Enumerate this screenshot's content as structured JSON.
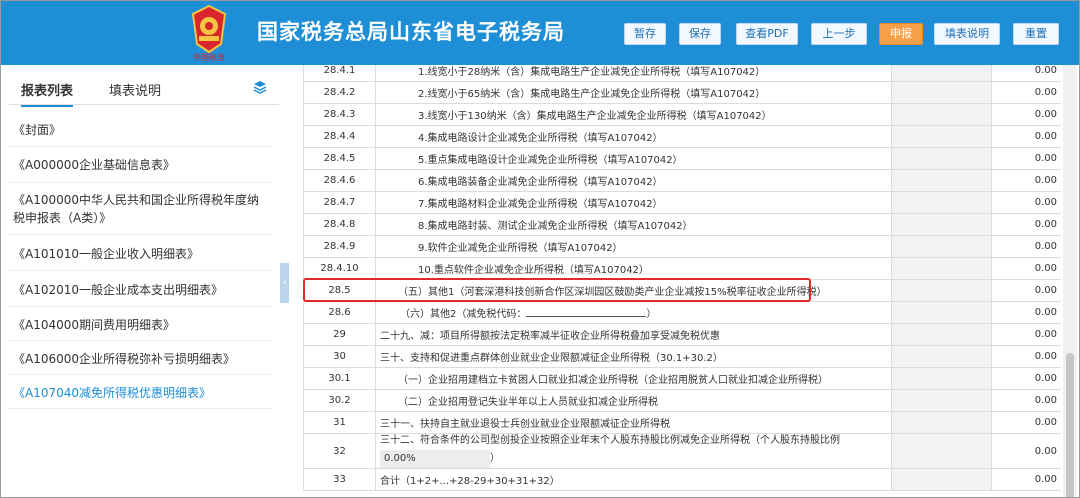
{
  "header": {
    "title": "国家税务总局山东省电子税务局",
    "emblem_text": "中国税务",
    "buttons": {
      "suspend": "暂存",
      "save": "保存",
      "view_pdf": "查看PDF",
      "previous": "上一步",
      "declare": "申报",
      "fill_instructions": "填表说明",
      "reset": "重置"
    }
  },
  "sidebar": {
    "tabs": {
      "report_list": "报表列表",
      "instructions": "填表说明"
    },
    "items": [
      {
        "label": "《封面》"
      },
      {
        "label": "《A000000企业基础信息表》"
      },
      {
        "label": "《A100000中华人民共和国企业所得税年度纳税申报表（A类）》"
      },
      {
        "label": "《A101010一般企业收入明细表》"
      },
      {
        "label": "《A102010一般企业成本支出明细表》"
      },
      {
        "label": "《A104000期间费用明细表》"
      },
      {
        "label": "《A106000企业所得税弥补亏损明细表》"
      },
      {
        "label": "《A107040减免所得税优惠明细表》"
      }
    ]
  },
  "table": {
    "rows": [
      {
        "no": "28.4.1",
        "name": "1.线宽小于28纳米（含）集成电路生产企业减免企业所得税（填写A107042）",
        "amount": "0.00"
      },
      {
        "no": "28.4.2",
        "name": "2.线宽小于65纳米（含）集成电路生产企业减免企业所得税（填写A107042）",
        "amount": "0.00"
      },
      {
        "no": "28.4.3",
        "name": "3.线宽小于130纳米（含）集成电路生产企业减免企业所得税（填写A107042）",
        "amount": "0.00"
      },
      {
        "no": "28.4.4",
        "name": "4.集成电路设计企业减免企业所得税（填写A107042）",
        "amount": "0.00"
      },
      {
        "no": "28.4.5",
        "name": "5.重点集成电路设计企业减免企业所得税（填写A107042）",
        "amount": "0.00"
      },
      {
        "no": "28.4.6",
        "name": "6.集成电路装备企业减免企业所得税（填写A107042）",
        "amount": "0.00"
      },
      {
        "no": "28.4.7",
        "name": "7.集成电路材料企业减免企业所得税（填写A107042）",
        "amount": "0.00"
      },
      {
        "no": "28.4.8",
        "name": "8.集成电路封装、测试企业减免企业所得税（填写A107042）",
        "amount": "0.00"
      },
      {
        "no": "28.4.9",
        "name": "9.软件企业减免企业所得税（填写A107042）",
        "amount": "0.00"
      },
      {
        "no": "28.4.10",
        "name": "10.重点软件企业减免企业所得税（填写A107042）",
        "amount": "0.00"
      },
      {
        "no": "28.5",
        "name": "（五）其他1（河套深港科技创新合作区深圳园区鼓励类产业企业减按15%税率征收企业所得税）",
        "amount": "0.00"
      },
      {
        "no": "28.6",
        "name_prefix": "（六）其他2（减免税代码：",
        "name_suffix": "）",
        "amount": "0.00"
      },
      {
        "no": "29",
        "name": "二十九、减：项目所得额按法定税率减半征收企业所得税叠加享受减免税优惠",
        "amount": "0.00"
      },
      {
        "no": "30",
        "name": "三十、支持和促进重点群体创业就业企业限额减征企业所得税（30.1+30.2）",
        "amount": "0.00"
      },
      {
        "no": "30.1",
        "name": "（一）企业招用建档立卡贫困人口就业扣减企业所得税（企业招用脱贫人口就业扣减企业所得税）",
        "amount": "0.00"
      },
      {
        "no": "30.2",
        "name": "（二）企业招用登记失业半年以上人员就业扣减企业所得税",
        "amount": "0.00"
      },
      {
        "no": "31",
        "name": "三十一、扶持自主就业退役士兵创业就业企业限额减征企业所得税",
        "amount": "0.00"
      },
      {
        "no": "32",
        "name": "三十二、符合条件的公司型创投企业按照企业年末个人股东持股比例减免企业所得税（个人股东持股比例",
        "ratio": "0.00%",
        "name_suffix": "）",
        "amount": "0.00"
      },
      {
        "no": "33",
        "name": "合计（1+2+...+28-29+30+31+32）",
        "amount": "0.00"
      }
    ]
  },
  "colors": {
    "header_bg": "#1e8ed6",
    "declare_button": "#f5a14a",
    "highlight_border": "#e02a2a",
    "active_link": "#1e8ed6"
  }
}
